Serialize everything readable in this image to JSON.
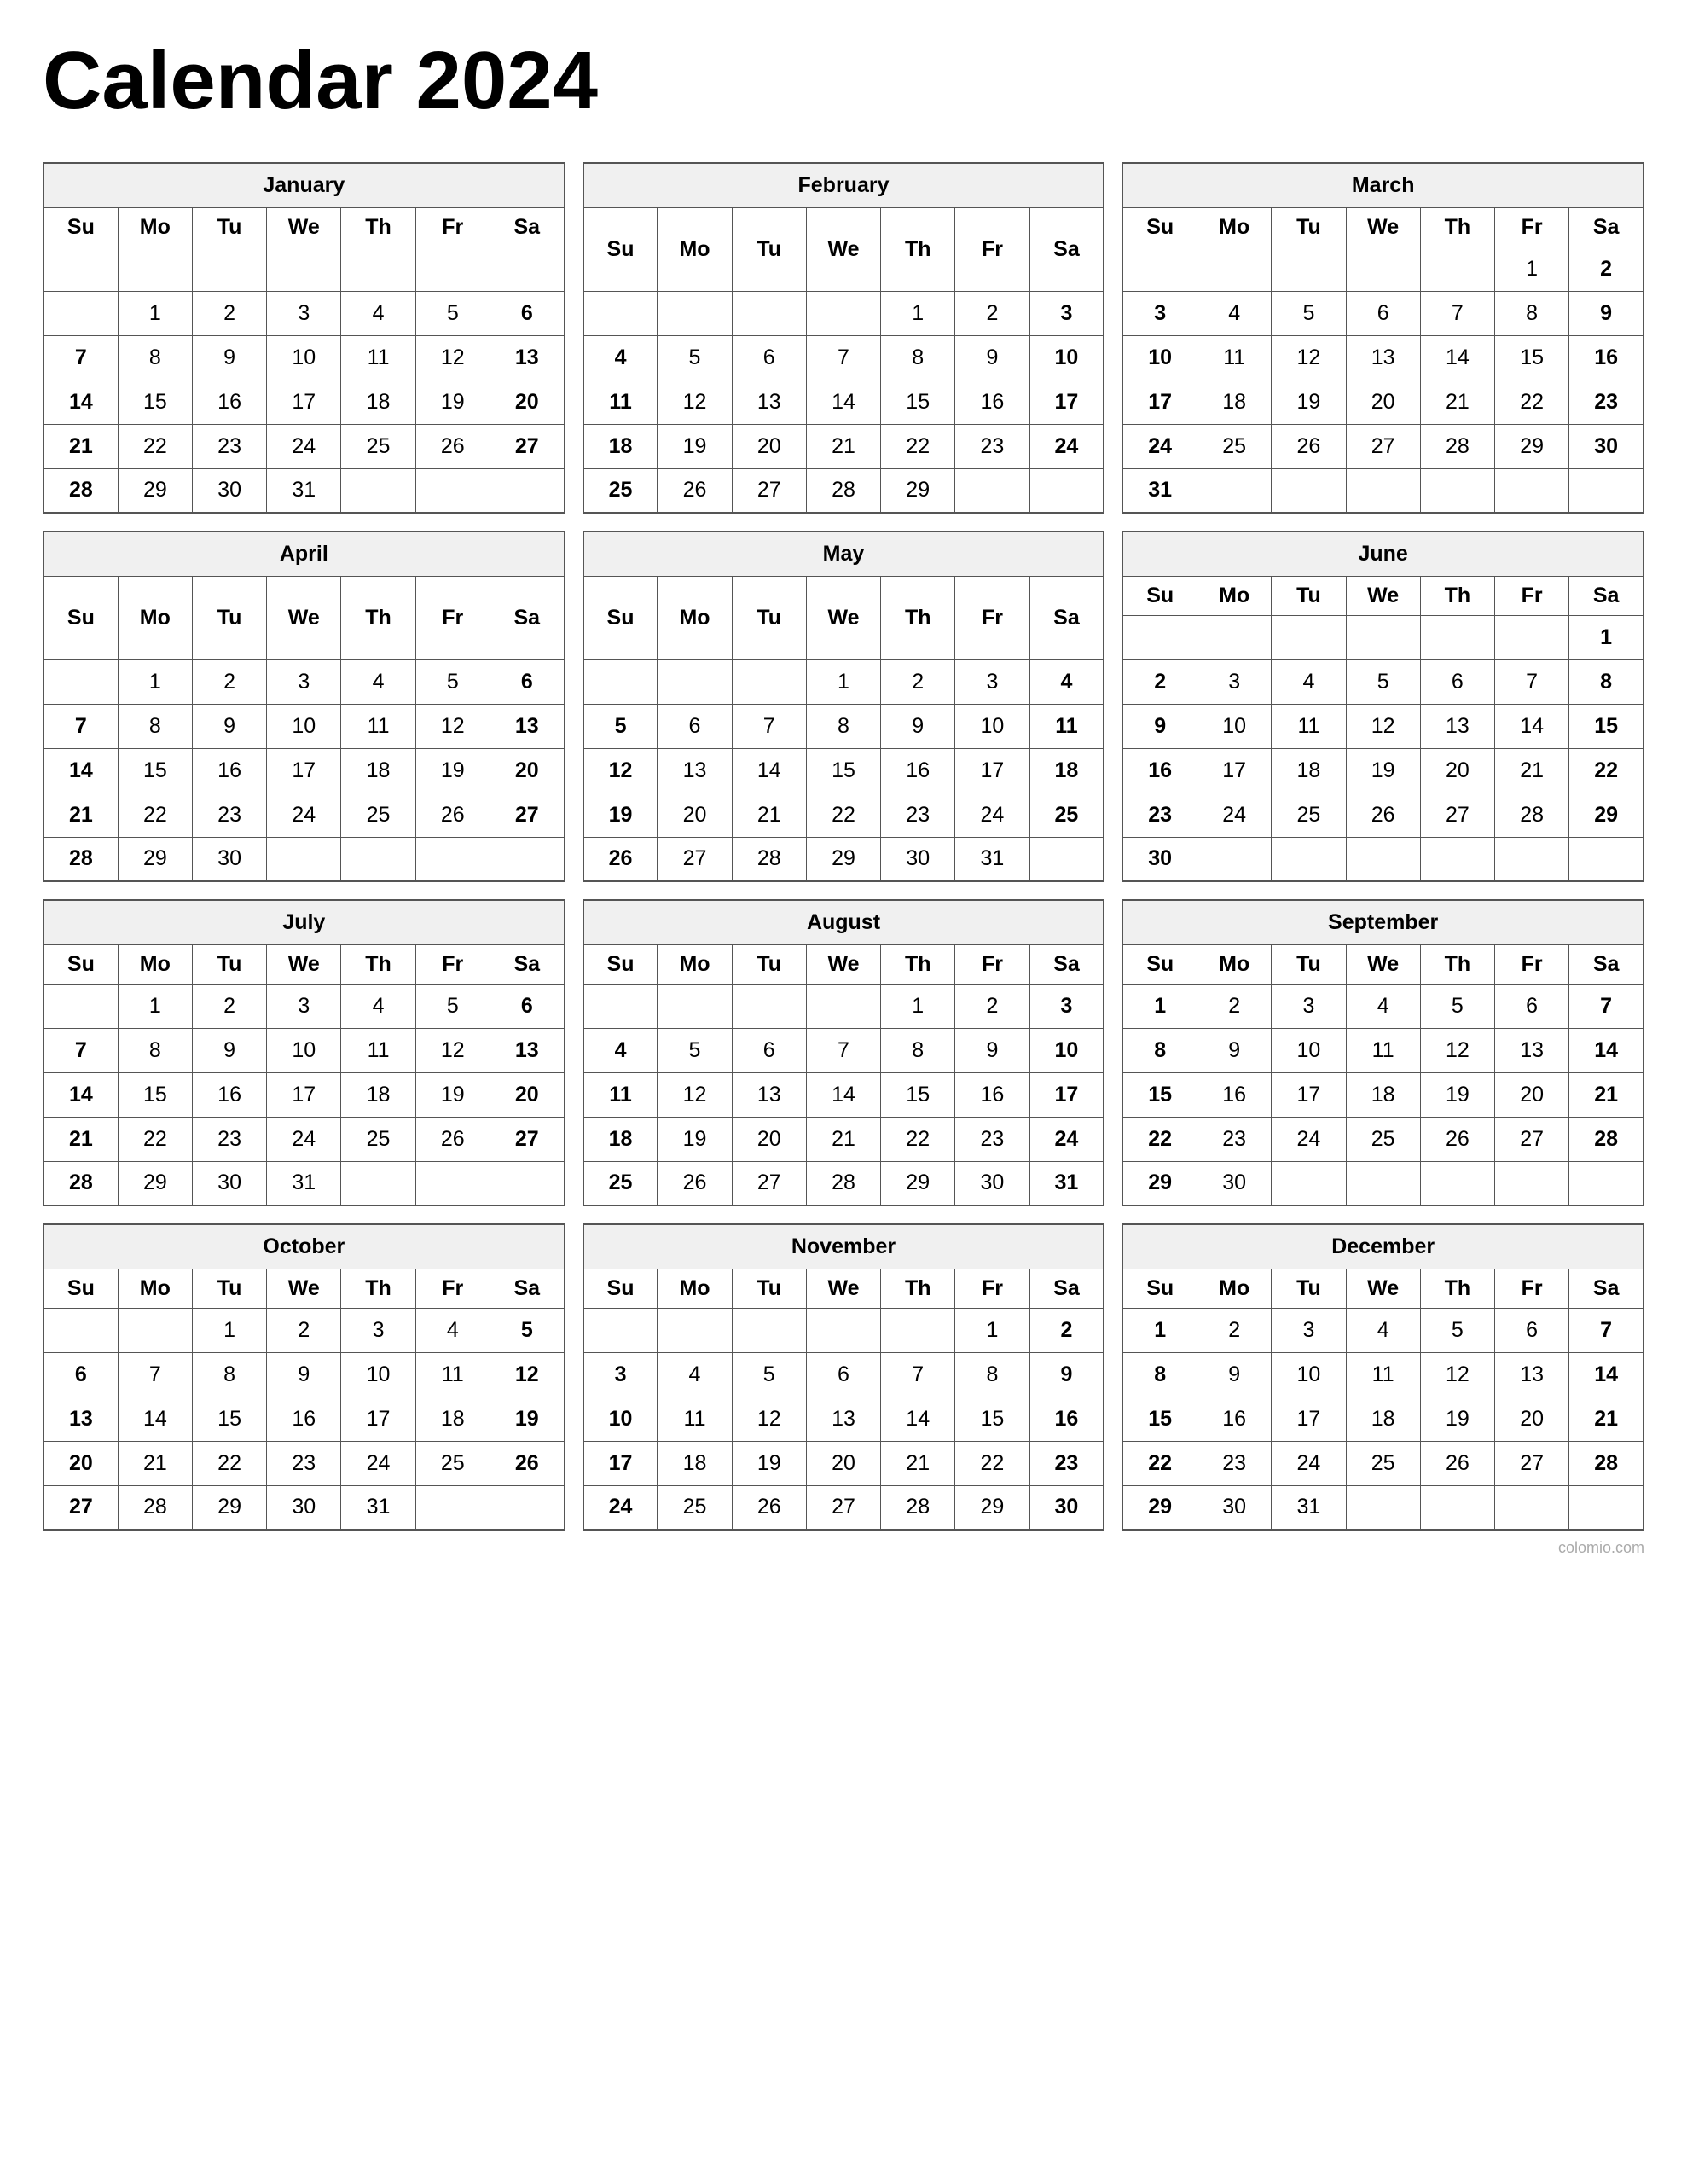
{
  "title": "Calendar 2024",
  "watermark": "colomio.com",
  "days_header": [
    "Su",
    "Mo",
    "Tu",
    "We",
    "Th",
    "Fr",
    "Sa"
  ],
  "months": [
    {
      "name": "January",
      "weeks": [
        [
          "",
          "",
          "",
          "",
          "",
          "",
          ""
        ],
        [
          "",
          "1",
          "2",
          "3",
          "4",
          "5",
          "6"
        ],
        [
          "7",
          "8",
          "9",
          "10",
          "11",
          "12",
          "13"
        ],
        [
          "14",
          "15",
          "16",
          "17",
          "18",
          "19",
          "20"
        ],
        [
          "21",
          "22",
          "23",
          "24",
          "25",
          "26",
          "27"
        ],
        [
          "28",
          "29",
          "30",
          "31",
          "",
          "",
          ""
        ]
      ]
    },
    {
      "name": "February",
      "weeks": [
        [
          "",
          "",
          "",
          "",
          "1",
          "2",
          "3"
        ],
        [
          "4",
          "5",
          "6",
          "7",
          "8",
          "9",
          "10"
        ],
        [
          "11",
          "12",
          "13",
          "14",
          "15",
          "16",
          "17"
        ],
        [
          "18",
          "19",
          "20",
          "21",
          "22",
          "23",
          "24"
        ],
        [
          "25",
          "26",
          "27",
          "28",
          "29",
          "",
          ""
        ]
      ]
    },
    {
      "name": "March",
      "weeks": [
        [
          "",
          "",
          "",
          "",
          "",
          "1",
          "2"
        ],
        [
          "3",
          "4",
          "5",
          "6",
          "7",
          "8",
          "9"
        ],
        [
          "10",
          "11",
          "12",
          "13",
          "14",
          "15",
          "16"
        ],
        [
          "17",
          "18",
          "19",
          "20",
          "21",
          "22",
          "23"
        ],
        [
          "24",
          "25",
          "26",
          "27",
          "28",
          "29",
          "30"
        ],
        [
          "31",
          "",
          "",
          "",
          "",
          "",
          ""
        ]
      ]
    },
    {
      "name": "April",
      "weeks": [
        [
          "",
          "1",
          "2",
          "3",
          "4",
          "5",
          "6"
        ],
        [
          "7",
          "8",
          "9",
          "10",
          "11",
          "12",
          "13"
        ],
        [
          "14",
          "15",
          "16",
          "17",
          "18",
          "19",
          "20"
        ],
        [
          "21",
          "22",
          "23",
          "24",
          "25",
          "26",
          "27"
        ],
        [
          "28",
          "29",
          "30",
          "",
          "",
          "",
          ""
        ]
      ]
    },
    {
      "name": "May",
      "weeks": [
        [
          "",
          "",
          "",
          "1",
          "2",
          "3",
          "4"
        ],
        [
          "5",
          "6",
          "7",
          "8",
          "9",
          "10",
          "11"
        ],
        [
          "12",
          "13",
          "14",
          "15",
          "16",
          "17",
          "18"
        ],
        [
          "19",
          "20",
          "21",
          "22",
          "23",
          "24",
          "25"
        ],
        [
          "26",
          "27",
          "28",
          "29",
          "30",
          "31",
          ""
        ]
      ]
    },
    {
      "name": "June",
      "weeks": [
        [
          "",
          "",
          "",
          "",
          "",
          "",
          "1"
        ],
        [
          "2",
          "3",
          "4",
          "5",
          "6",
          "7",
          "8"
        ],
        [
          "9",
          "10",
          "11",
          "12",
          "13",
          "14",
          "15"
        ],
        [
          "16",
          "17",
          "18",
          "19",
          "20",
          "21",
          "22"
        ],
        [
          "23",
          "24",
          "25",
          "26",
          "27",
          "28",
          "29"
        ],
        [
          "30",
          "",
          "",
          "",
          "",
          "",
          ""
        ]
      ]
    },
    {
      "name": "July",
      "weeks": [
        [
          "",
          "1",
          "2",
          "3",
          "4",
          "5",
          "6"
        ],
        [
          "7",
          "8",
          "9",
          "10",
          "11",
          "12",
          "13"
        ],
        [
          "14",
          "15",
          "16",
          "17",
          "18",
          "19",
          "20"
        ],
        [
          "21",
          "22",
          "23",
          "24",
          "25",
          "26",
          "27"
        ],
        [
          "28",
          "29",
          "30",
          "31",
          "",
          "",
          ""
        ]
      ]
    },
    {
      "name": "August",
      "weeks": [
        [
          "",
          "",
          "",
          "",
          "1",
          "2",
          "3"
        ],
        [
          "4",
          "5",
          "6",
          "7",
          "8",
          "9",
          "10"
        ],
        [
          "11",
          "12",
          "13",
          "14",
          "15",
          "16",
          "17"
        ],
        [
          "18",
          "19",
          "20",
          "21",
          "22",
          "23",
          "24"
        ],
        [
          "25",
          "26",
          "27",
          "28",
          "29",
          "30",
          "31"
        ]
      ]
    },
    {
      "name": "September",
      "weeks": [
        [
          "1",
          "2",
          "3",
          "4",
          "5",
          "6",
          "7"
        ],
        [
          "8",
          "9",
          "10",
          "11",
          "12",
          "13",
          "14"
        ],
        [
          "15",
          "16",
          "17",
          "18",
          "19",
          "20",
          "21"
        ],
        [
          "22",
          "23",
          "24",
          "25",
          "26",
          "27",
          "28"
        ],
        [
          "29",
          "30",
          "",
          "",
          "",
          "",
          ""
        ]
      ]
    },
    {
      "name": "October",
      "weeks": [
        [
          "",
          "",
          "1",
          "2",
          "3",
          "4",
          "5"
        ],
        [
          "6",
          "7",
          "8",
          "9",
          "10",
          "11",
          "12"
        ],
        [
          "13",
          "14",
          "15",
          "16",
          "17",
          "18",
          "19"
        ],
        [
          "20",
          "21",
          "22",
          "23",
          "24",
          "25",
          "26"
        ],
        [
          "27",
          "28",
          "29",
          "30",
          "31",
          "",
          ""
        ]
      ]
    },
    {
      "name": "November",
      "weeks": [
        [
          "",
          "",
          "",
          "",
          "",
          "1",
          "2"
        ],
        [
          "3",
          "4",
          "5",
          "6",
          "7",
          "8",
          "9"
        ],
        [
          "10",
          "11",
          "12",
          "13",
          "14",
          "15",
          "16"
        ],
        [
          "17",
          "18",
          "19",
          "20",
          "21",
          "22",
          "23"
        ],
        [
          "24",
          "25",
          "26",
          "27",
          "28",
          "29",
          "30"
        ]
      ]
    },
    {
      "name": "December",
      "weeks": [
        [
          "1",
          "2",
          "3",
          "4",
          "5",
          "6",
          "7"
        ],
        [
          "8",
          "9",
          "10",
          "11",
          "12",
          "13",
          "14"
        ],
        [
          "15",
          "16",
          "17",
          "18",
          "19",
          "20",
          "21"
        ],
        [
          "22",
          "23",
          "24",
          "25",
          "26",
          "27",
          "28"
        ],
        [
          "29",
          "30",
          "31",
          "",
          "",
          "",
          ""
        ]
      ]
    }
  ]
}
